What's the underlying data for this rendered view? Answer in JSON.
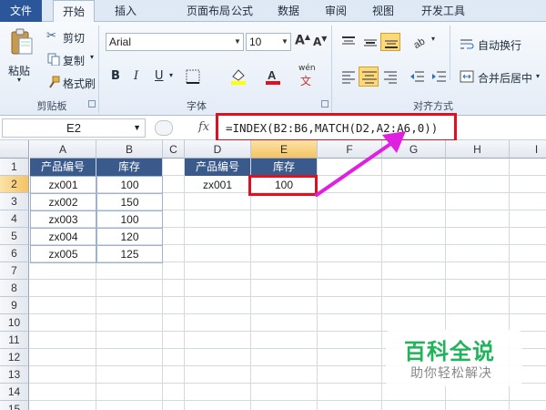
{
  "tabs": {
    "file": "文件",
    "home": "开始",
    "insert": "插入",
    "layout": "页面布局",
    "formulas": "公式",
    "data": "数据",
    "review": "审阅",
    "view": "视图",
    "developer": "开发工具"
  },
  "clipboard": {
    "paste": "粘贴",
    "cut": "剪切",
    "copy": "复制",
    "format_painter": "格式刷",
    "group": "剪贴板"
  },
  "font": {
    "name": "Arial",
    "size": "10",
    "group": "字体",
    "bold": "B",
    "italic": "I",
    "underline": "U",
    "wen": "wén"
  },
  "alignment": {
    "wrap": "自动换行",
    "merge": "合并后居中",
    "group": "对齐方式"
  },
  "formula_bar": {
    "name_box": "E2",
    "fx": "fx",
    "formula": "=INDEX(B2:B6,MATCH(D2,A2:A6,0))"
  },
  "sheet": {
    "columns": [
      "A",
      "B",
      "C",
      "D",
      "E",
      "F",
      "G",
      "H",
      "I"
    ],
    "rows": [
      "1",
      "2",
      "3",
      "4",
      "5",
      "6",
      "7",
      "8",
      "9",
      "10",
      "11",
      "12",
      "13",
      "14",
      "15"
    ],
    "table1_headers": [
      "产品编号",
      "库存"
    ],
    "table1_rows": [
      [
        "zx001",
        "100"
      ],
      [
        "zx002",
        "150"
      ],
      [
        "zx003",
        "100"
      ],
      [
        "zx004",
        "120"
      ],
      [
        "zx005",
        "125"
      ]
    ],
    "table2_headers": [
      "产品编号",
      "库存"
    ],
    "table2_row": [
      "zx001",
      "100"
    ]
  },
  "watermark": {
    "title": "百科全说",
    "subtitle": "助你轻松解决"
  },
  "colors": {
    "header_fill": "#3a5a8c",
    "highlight": "#e0101e",
    "arrow": "#e020e0",
    "watermark": "#1fb35a"
  }
}
